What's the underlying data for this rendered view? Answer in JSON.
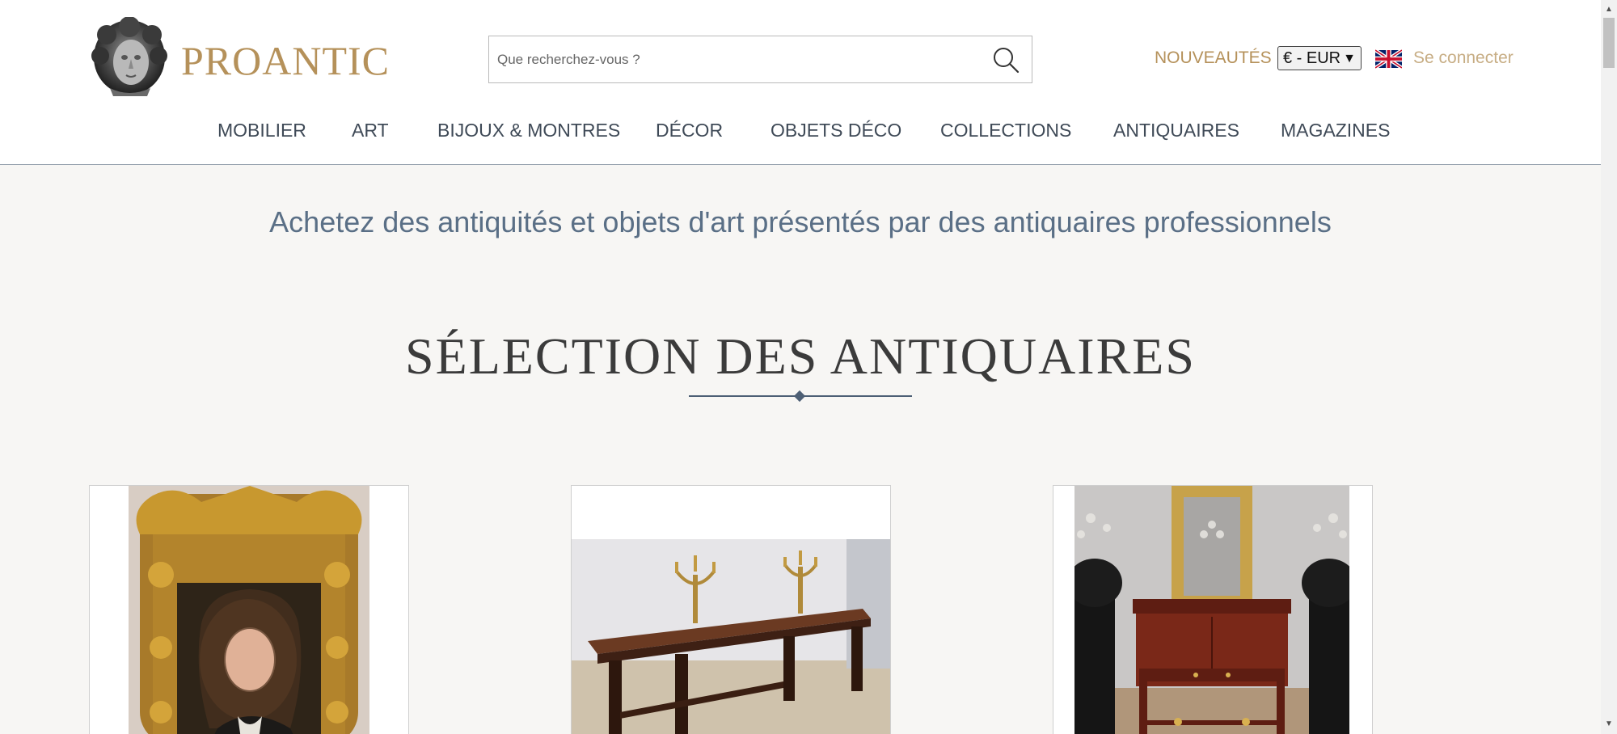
{
  "header": {
    "logo_text": "PROANTIC",
    "search_placeholder": "Que recherchez-vous ?",
    "nouveautes": "NOUVEAUTÉS",
    "currency": "€ - EUR",
    "language_flag": "uk-flag-icon",
    "login": "Se connecter"
  },
  "nav": {
    "items": [
      {
        "label": "MOBILIER"
      },
      {
        "label": "ART"
      },
      {
        "label": "BIJOUX & MONTRES"
      },
      {
        "label": "DÉCOR"
      },
      {
        "label": "OBJETS DÉCO"
      },
      {
        "label": "COLLECTIONS"
      },
      {
        "label": "ANTIQUAIRES"
      },
      {
        "label": "MAGAZINES"
      }
    ]
  },
  "main": {
    "tagline": "Achetez des antiquités et objets d'art présentés par des antiquaires professionnels",
    "section_title": "SÉLECTION DES ANTIQUAIRES",
    "cards": [
      {
        "image": "portrait-in-gilded-frame"
      },
      {
        "image": "antique-wooden-table-with-candelabras"
      },
      {
        "image": "mahogany-cabinet-with-mirror"
      }
    ]
  },
  "colors": {
    "brand_gold": "#b5915a",
    "nav_text": "#3f4a57",
    "tagline": "#5a6f86",
    "accent_rule": "#4d5f75"
  }
}
